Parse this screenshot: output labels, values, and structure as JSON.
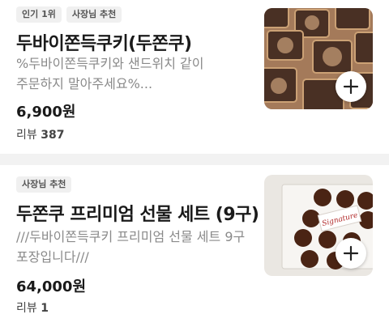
{
  "products": [
    {
      "badges": [
        "인기 1위",
        "사장님 추천"
      ],
      "name": "두바이쫀득쿠키(두쫀쿠)",
      "description": "%두바이쫀득쿠키와 샌드위치 같이 주문하지 말아주세요%...",
      "price": "6,900원",
      "review_label": "리뷰",
      "review_count": "387",
      "thumbnail_icon": "chocolate-box-photo",
      "add_icon": "plus-icon"
    },
    {
      "badges": [
        "사장님 추천"
      ],
      "name": "두쫀쿠 프리미엄 선물 세트 (9구)",
      "description": "///두바이쫀득쿠키 프리미엄 선물 세트 9구 포장입니다///",
      "price": "64,000원",
      "review_label": "리뷰",
      "review_count": "1",
      "thumbnail_icon": "gift-set-photo",
      "thumbnail_card_text": "Signature",
      "add_icon": "plus-icon"
    }
  ],
  "colors": {
    "badge_bg": "#f0f0f0",
    "desc_text": "#8a8a8a",
    "divider": "#f2f2f2"
  }
}
